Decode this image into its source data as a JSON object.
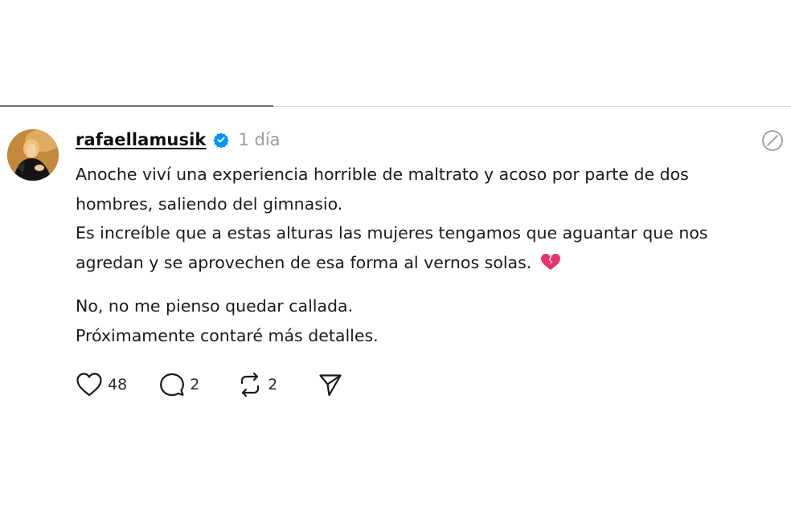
{
  "post": {
    "username": "rafaellamusik",
    "time": "1 día",
    "paragraph1": [
      "Anoche viví una experiencia horrible de maltrato y acoso por parte de dos",
      "hombres, saliendo del gimnasio.",
      "Es increíble que a estas alturas las mujeres tengamos que aguantar que nos",
      "agredan y se aprovechen de esa forma al vernos solas."
    ],
    "paragraph2": [
      "No, no me pienso quedar callada.",
      "Próximamente contaré más detalles."
    ],
    "emoji": "broken-heart",
    "stats": {
      "likes": "48",
      "replies": "2",
      "reposts": "2"
    }
  },
  "icons": {
    "verified": "verified-badge-icon",
    "more": "more-icon",
    "like": "heart-icon",
    "reply": "comment-icon",
    "repost": "repost-icon",
    "share": "send-icon"
  },
  "colors": {
    "verified_blue": "#0095f6",
    "text": "#1a1a1a",
    "muted": "#9a9a9a",
    "emoji_pink": "#e8336a"
  }
}
